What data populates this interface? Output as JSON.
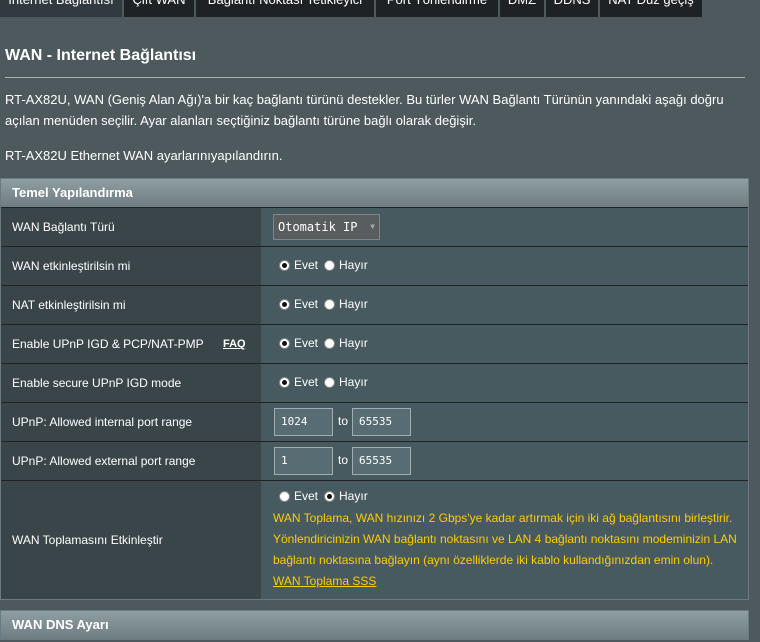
{
  "tabs": [
    "Internet Bağlantısı",
    "Çift WAN",
    "Bağlantı Noktası Tetikleyici",
    "Port Yönlendirme",
    "DMZ",
    "DDNS",
    "NAT Düz geçiş"
  ],
  "page": {
    "title": "WAN - Internet Bağlantısı",
    "description": "RT-AX82U, WAN (Geniş Alan Ağı)'a bir kaç bağlantı türünü destekler. Bu türler WAN Bağlantı Türünün yanındaki aşağı doğru açılan menüden seçilir. Ayar alanları seçtiğiniz bağlantı türüne bağlı olarak değişir.",
    "description2": "RT-AX82U Ethernet WAN ayarlarınıyapılandırın."
  },
  "basic": {
    "header": "Temel Yapılandırma",
    "wan_type_label": "WAN Bağlantı Türü",
    "wan_type_value": "Otomatik IP",
    "wan_enable_label": "WAN etkinleştirilsin mi",
    "nat_enable_label": "NAT etkinleştirilsin mi",
    "upnp_label": "Enable UPnP IGD & PCP/NAT-PMP",
    "faq": "FAQ",
    "secure_upnp_label": "Enable secure UPnP IGD mode",
    "int_range_label": "UPnP: Allowed internal port range",
    "int_from": "1024",
    "int_to": "65535",
    "ext_range_label": "UPnP: Allowed external port range",
    "ext_from": "1",
    "ext_to": "65535",
    "to": "to",
    "agg_label": "WAN Toplamasını Etkinleştir",
    "agg_note": "WAN Toplama, WAN hızınızı 2 Gbps'ye kadar artırmak için iki ağ bağlantısını birleştirir. Yönlendiricinizin WAN bağlantı noktasını ve LAN 4 bağlantı noktasını modeminizin LAN bağlantı noktasına bağlayın (aynı özelliklerde iki kablo kullandığınızdan emin olun).",
    "agg_link": "WAN Toplama SSS"
  },
  "radio": {
    "yes": "Evet",
    "no": "Hayır"
  },
  "dns": {
    "header": "WAN DNS Ayarı"
  }
}
